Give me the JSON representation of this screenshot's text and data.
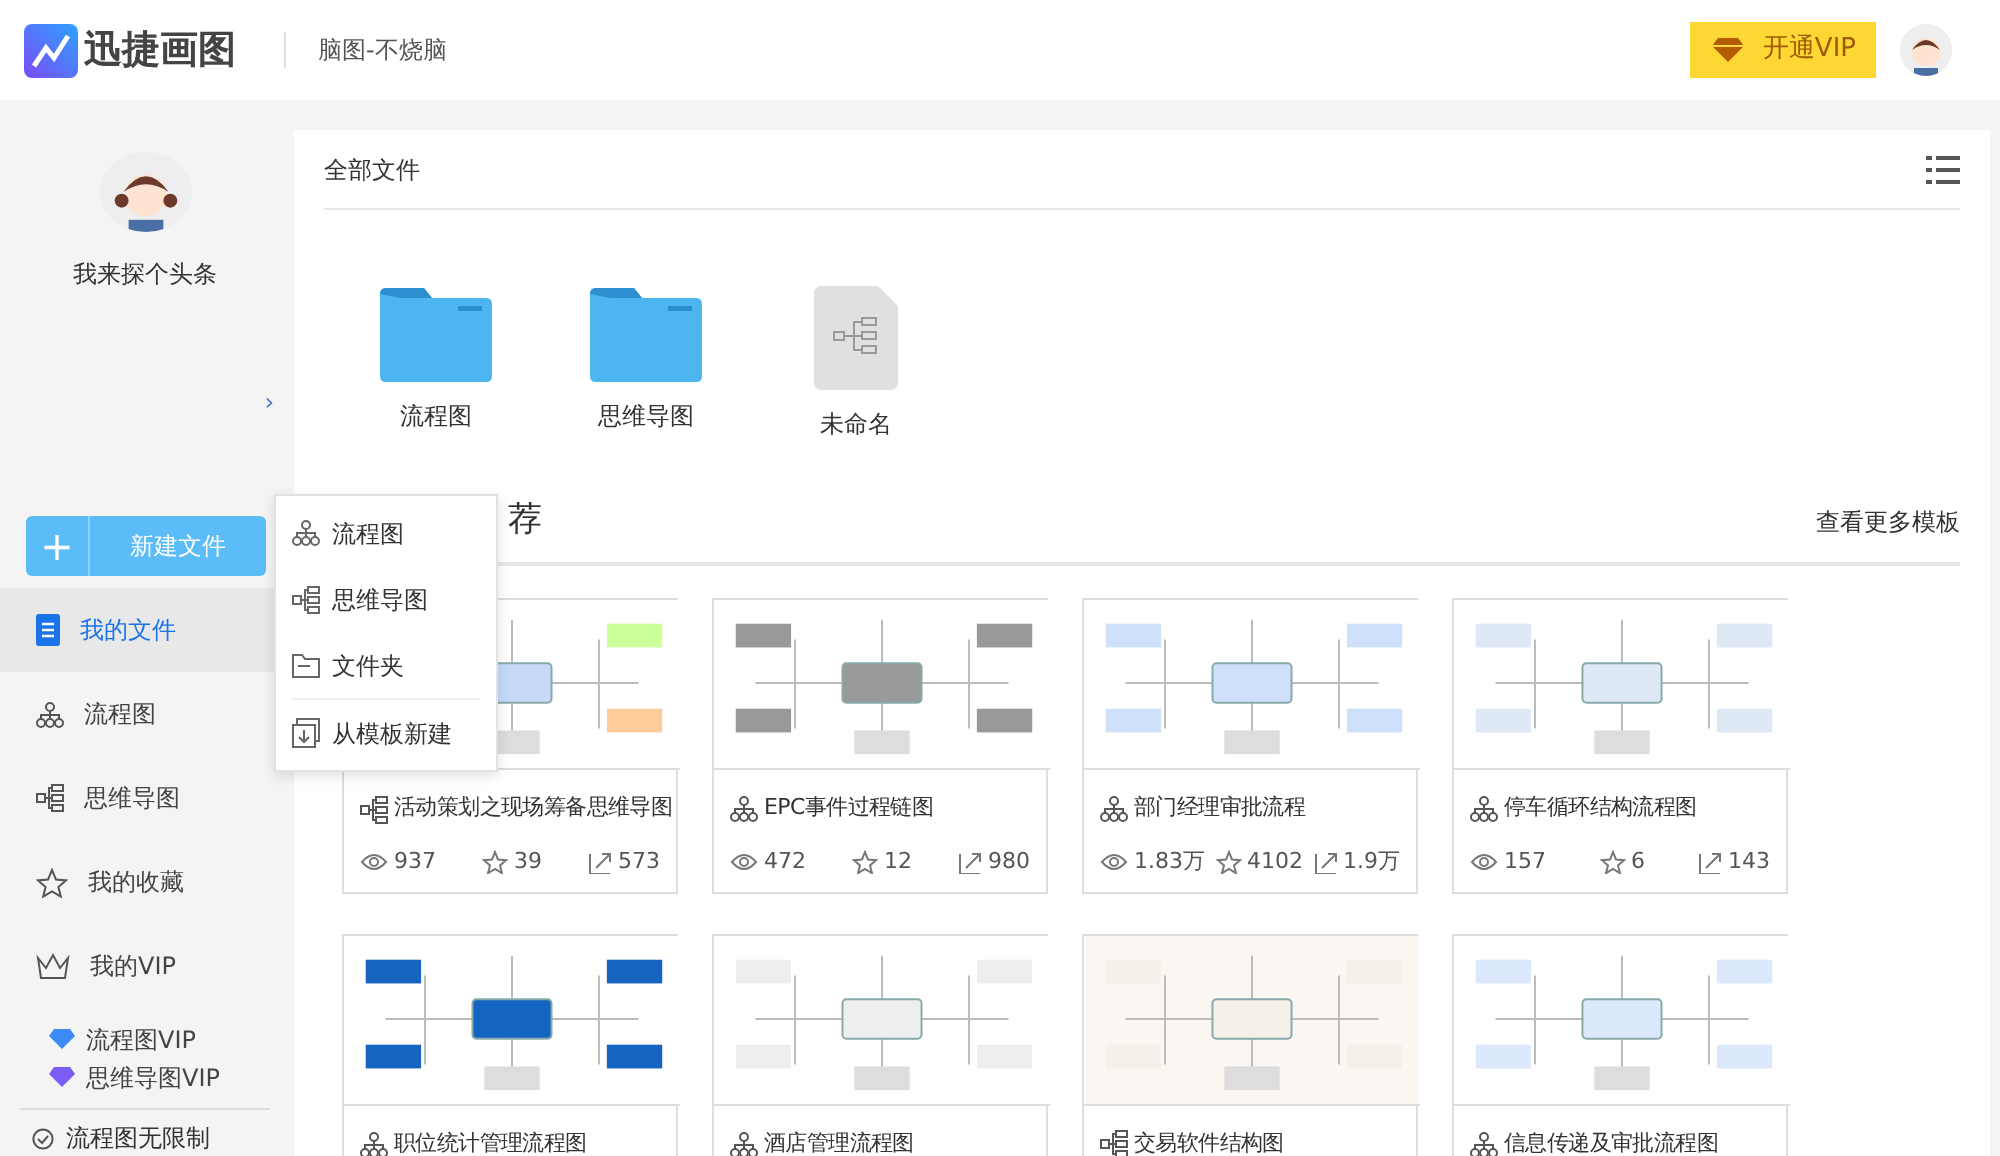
{
  "header": {
    "logo": "迅捷画图",
    "subtitle": "脑图-不烧脑",
    "vip_button": "开通VIP"
  },
  "sidebar": {
    "user_name": "我来探个头条",
    "collapse": "›",
    "new_button": {
      "icon": "+",
      "label": "新建文件"
    },
    "items": [
      {
        "label": "我的文件",
        "kind": "file",
        "selected": true
      },
      {
        "label": "流程图",
        "kind": "flow",
        "selected": false
      },
      {
        "label": "思维导图",
        "kind": "mind",
        "selected": false
      },
      {
        "label": "我的收藏",
        "kind": "star",
        "selected": false
      },
      {
        "label": "我的VIP",
        "kind": "crown",
        "selected": false
      }
    ],
    "vip_lines": [
      {
        "label": "流程图VIP",
        "color": "#3d8af7"
      },
      {
        "label": "思维导图VIP",
        "color": "#7b5cf5"
      }
    ],
    "footer": "流程图无限制"
  },
  "new_menu": [
    {
      "label": "流程图",
      "kind": "flow"
    },
    {
      "label": "思维导图",
      "kind": "mind"
    },
    {
      "label": "文件夹",
      "kind": "folder"
    },
    {
      "label": "从模板新建",
      "kind": "template"
    }
  ],
  "files": {
    "title": "全部文件",
    "items": [
      {
        "label": "流程图",
        "kind": "folder"
      },
      {
        "label": "思维导图",
        "kind": "folder"
      },
      {
        "label": "未命名",
        "kind": "doc"
      }
    ]
  },
  "templates": {
    "title": "荐",
    "more": "查看更多模板",
    "cards": [
      {
        "title": "活动策划之现场筹备思维导图",
        "kind": "mind",
        "views": "937",
        "stars": "39",
        "uses": "573"
      },
      {
        "title": "EPC事件过程链图",
        "kind": "flow",
        "views": "472",
        "stars": "12",
        "uses": "980"
      },
      {
        "title": "部门经理审批流程",
        "kind": "flow",
        "views": "1.83万",
        "stars": "4102",
        "uses": "1.9万"
      },
      {
        "title": "停车循环结构流程图",
        "kind": "flow",
        "views": "157",
        "stars": "6",
        "uses": "143"
      },
      {
        "title": "职位统计管理流程图",
        "kind": "flow"
      },
      {
        "title": "酒店管理流程图",
        "kind": "flow"
      },
      {
        "title": "交易软件结构图",
        "kind": "mind"
      },
      {
        "title": "信息传递及审批流程图",
        "kind": "flow"
      }
    ]
  }
}
